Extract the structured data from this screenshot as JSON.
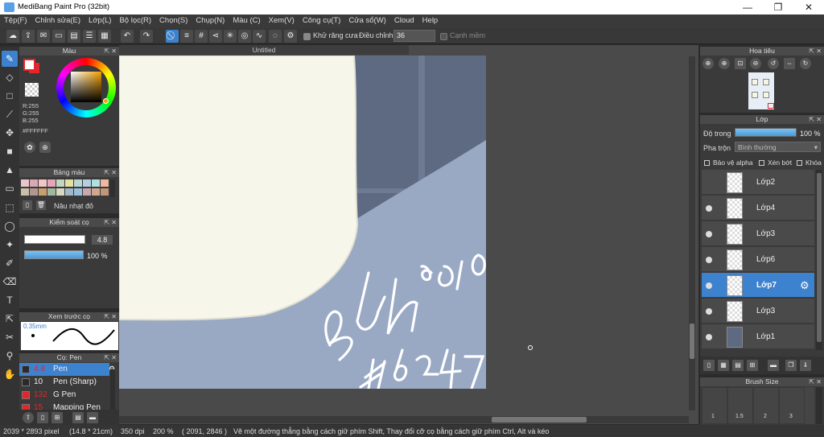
{
  "window": {
    "title": "MediBang Paint Pro (32bit)",
    "minimize": "—",
    "maximize": "❐",
    "close": "✕"
  },
  "menu": [
    "Tệp(F)",
    "Chỉnh sửa(E)",
    "Lớp(L)",
    "Bộ lọc(R)",
    "Chọn(S)",
    "Chụp(N)",
    "Màu (C)",
    "Xem(V)",
    "Công cụ(T)",
    "Cửa sổ(W)",
    "Cloud",
    "Help"
  ],
  "toolbar": {
    "antialias_label": "Khử răng cưa",
    "adjust_label": "Điều chỉnh",
    "adjust_value": "36",
    "smooth_label": "Cạnh mềm"
  },
  "color_panel": {
    "title": "Màu",
    "r": "R:255",
    "g": "G:255",
    "b": "B:255",
    "hex": "#FFFFFF",
    "fg": "#FFFFFF",
    "bg": "#E5242B"
  },
  "palette_panel": {
    "title": "Bảng màu",
    "color_name": "Nâu nhạt đỏ",
    "swatches": [
      "#e9c6cc",
      "#d6a9b3",
      "#f2c6c6",
      "#e6a6b9",
      "#c5d6c0",
      "#e6e0a0",
      "#b8d7d3",
      "#b5cfe0",
      "#b0e0e0",
      "#f0b8a0",
      "#c8c0a8",
      "#b09890",
      "#c8a070",
      "#a0b8a0",
      "#d8d8c0",
      "#a0b8c8",
      "#98c0d8",
      "#c8a8b0",
      "#d0a890",
      "#c09878"
    ]
  },
  "brush_control": {
    "title": "Kiểm soát cọ",
    "size": "4.8",
    "opacity": "100 %",
    "opacity_fraction": 1.0
  },
  "brush_preview": {
    "title": "Xem trước cọ",
    "size": "0.35mm"
  },
  "brush_list": {
    "title": "Cọ: Pen",
    "items": [
      {
        "size": "4.8",
        "name": "Pen",
        "color": "#2a2a2a",
        "sizecolor": "#e5242b",
        "selected": true
      },
      {
        "size": "10",
        "name": "Pen (Sharp)",
        "color": "#2a2a2a",
        "sizecolor": "#eeeeee",
        "selected": false
      },
      {
        "size": "132",
        "name": "G Pen",
        "color": "#e5242b",
        "sizecolor": "#e5242b",
        "selected": false
      },
      {
        "size": "15",
        "name": "Mapping Pen",
        "color": "#e5242b",
        "sizecolor": "#e5242b",
        "selected": false
      }
    ]
  },
  "canvas": {
    "tab": "Untitled",
    "signature": "BÚN 0210",
    "tag": "#d247"
  },
  "navigator": {
    "title": "Hoa tiêu"
  },
  "layer_panel": {
    "title": "Lớp",
    "opacity_label": "Độ trong",
    "opacity_value": "100 %",
    "opacity_fraction": 1.0,
    "blend_label": "Pha trộn",
    "blend_value": "Bình thường",
    "protect_alpha": "Bảo vệ alpha",
    "clipping": "Xén bớt",
    "lock": "Khóa",
    "layers": [
      {
        "name": "Lớp2",
        "visible": false,
        "selected": false
      },
      {
        "name": "Lớp4",
        "visible": true,
        "selected": false
      },
      {
        "name": "Lớp3",
        "visible": true,
        "selected": false
      },
      {
        "name": "Lớp6",
        "visible": true,
        "selected": false
      },
      {
        "name": "Lớp7",
        "visible": true,
        "selected": true
      },
      {
        "name": "Lớp3",
        "visible": true,
        "selected": false
      },
      {
        "name": "Lớp1",
        "visible": true,
        "selected": false
      }
    ]
  },
  "brush_size": {
    "title": "Brush Size",
    "values": [
      "1",
      "1.5",
      "2",
      "3"
    ]
  },
  "status": {
    "pixels": "2039 * 2893 pixel",
    "size": "(14.8 * 21cm)",
    "dpi": "350 dpi",
    "zoom": "200 %",
    "coords": "( 2091, 2846 )",
    "hint": "Vẽ một đường thẳng bằng cách giữ phím Shift, Thay đổi cỡ cọ bằng cách giữ phím Ctrl, Alt và kéo"
  }
}
